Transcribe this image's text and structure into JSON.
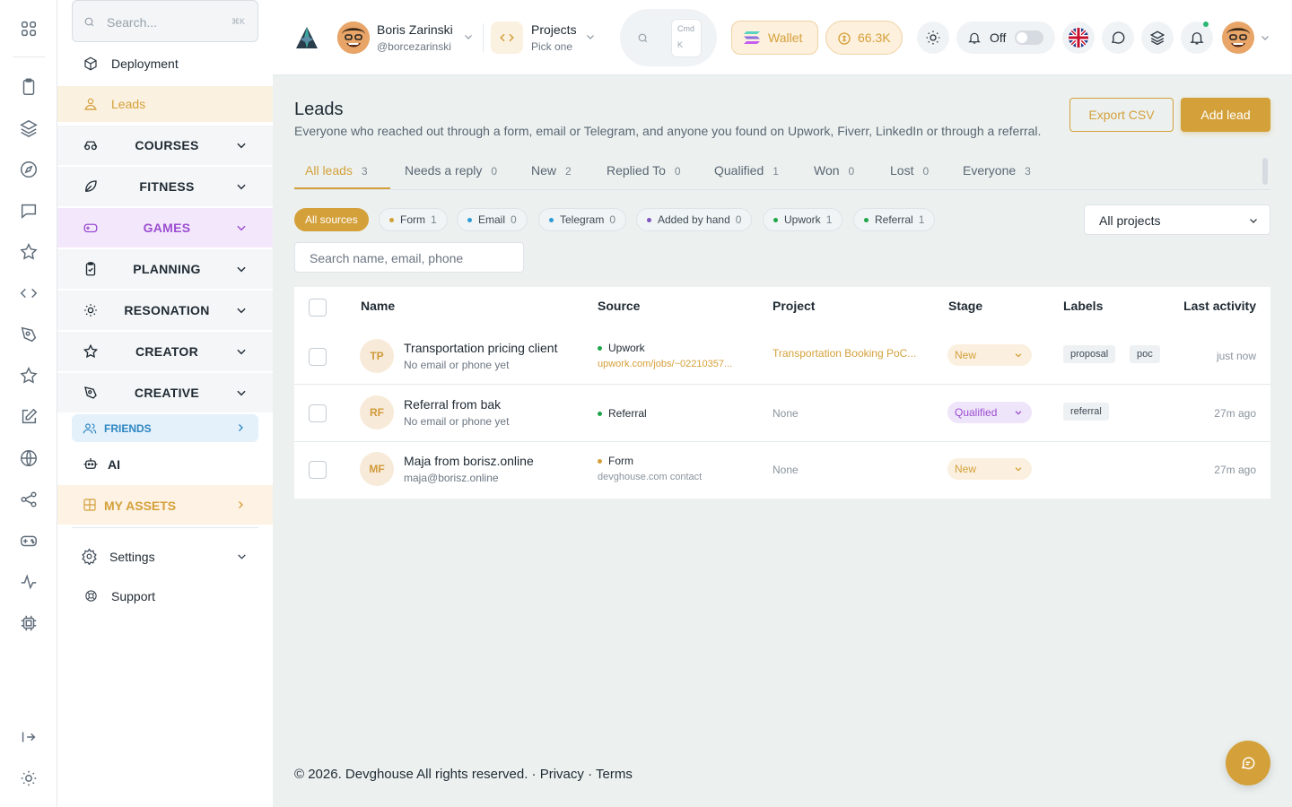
{
  "sidebar": {
    "search_placeholder": "Search...",
    "search_shortcut": "⌘K",
    "items": [
      {
        "label": "Deployment",
        "icon": "cube-icon"
      },
      {
        "label": "Leads",
        "icon": "users-icon"
      }
    ],
    "groups": [
      {
        "label": "COURSES",
        "icon": "glasses-icon"
      },
      {
        "label": "FITNESS",
        "icon": "leaf-icon"
      },
      {
        "label": "GAMES",
        "icon": "gamepad-icon"
      },
      {
        "label": "PLANNING",
        "icon": "clipboard-check-icon"
      },
      {
        "label": "RESONATION",
        "icon": "sun-icon"
      },
      {
        "label": "CREATOR",
        "icon": "star-icon"
      },
      {
        "label": "CREATIVE",
        "icon": "pen-tool-icon"
      }
    ],
    "friends_label": "FRIENDS",
    "ai_label": "AI",
    "my_assets_label": "MY ASSETS",
    "settings_label": "Settings",
    "support_label": "Support"
  },
  "topbar": {
    "user_name": "Boris Zarinski",
    "user_handle": "@borcezarinski",
    "projects_label": "Projects",
    "projects_sub": "Pick one",
    "cmd_key": "Cmd",
    "k_key": "K",
    "wallet_label": "Wallet",
    "balance": "66.3K",
    "notifications_toggle": "Off"
  },
  "page": {
    "title": "Leads",
    "description": "Everyone who reached out through a form, email or Telegram, and anyone you found on Upwork, Fiverr, LinkedIn or through a referral.",
    "export_label": "Export CSV",
    "add_label": "Add lead",
    "search_placeholder": "Search name, email, phone",
    "projects_select": "All projects"
  },
  "tabs": [
    {
      "label": "All leads",
      "count": "3"
    },
    {
      "label": "Needs a reply",
      "count": "0"
    },
    {
      "label": "New",
      "count": "2"
    },
    {
      "label": "Replied To",
      "count": "0"
    },
    {
      "label": "Qualified",
      "count": "1"
    },
    {
      "label": "Won",
      "count": "0"
    },
    {
      "label": "Lost",
      "count": "0"
    },
    {
      "label": "Everyone",
      "count": "3"
    }
  ],
  "sources": [
    {
      "label": "All sources"
    },
    {
      "label": "Form",
      "count": "1",
      "color": "#d4a03a"
    },
    {
      "label": "Email",
      "count": "0",
      "color": "#2e9bd6"
    },
    {
      "label": "Telegram",
      "count": "0",
      "color": "#2e9bd6"
    },
    {
      "label": "Added by hand",
      "count": "0",
      "color": "#7e57c2"
    },
    {
      "label": "Upwork",
      "count": "1",
      "color": "#1fa64a"
    },
    {
      "label": "Referral",
      "count": "1",
      "color": "#1fa64a"
    }
  ],
  "table": {
    "headers": [
      "Name",
      "Source",
      "Project",
      "Stage",
      "Labels",
      "Last activity"
    ],
    "rows": [
      {
        "initials": "TP",
        "name": "Transportation pricing client",
        "sub": "No email or phone yet",
        "source": "Upwork",
        "source_color": "#1fa64a",
        "source_sub": "upwork.com/jobs/~02210357...",
        "project": "Transportation Booking PoC...",
        "stage": "New",
        "labels": [
          "proposal",
          "poc"
        ],
        "last": "just now"
      },
      {
        "initials": "RF",
        "name": "Referral from bak",
        "sub": "No email or phone yet",
        "source": "Referral",
        "source_color": "#1fa64a",
        "source_sub": "",
        "project": "None",
        "stage": "Qualified",
        "labels": [
          "referral"
        ],
        "last": "27m ago"
      },
      {
        "initials": "MF",
        "name": "Maja from borisz.online",
        "sub": "maja@borisz.online",
        "source": "Form",
        "source_color": "#d4a03a",
        "source_sub": "devghouse.com contact",
        "project": "None",
        "stage": "New",
        "labels": [],
        "last": "27m ago"
      }
    ]
  },
  "footer": {
    "copyright": "© 2026. Devghouse All rights reserved.",
    "sep": "·",
    "privacy": "Privacy",
    "terms": "Terms"
  },
  "colors": {
    "accent": "#d4a03a",
    "games": "#9b4dd1",
    "friends": "#2e86c1"
  }
}
